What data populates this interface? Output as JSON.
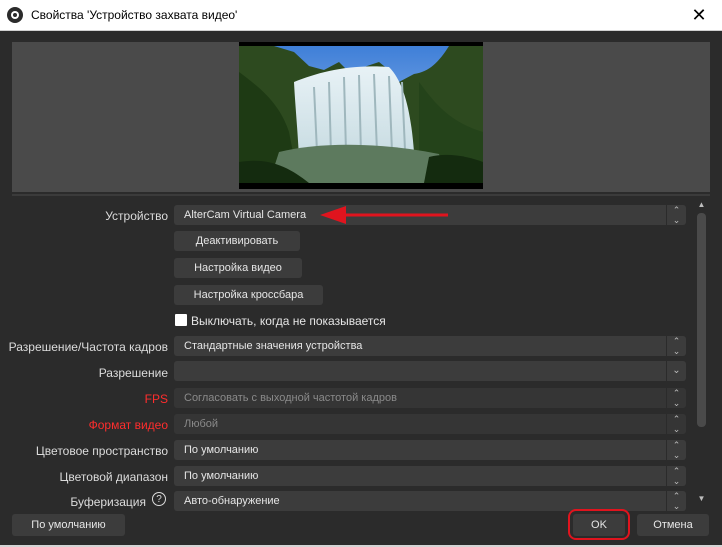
{
  "window": {
    "title": "Свойства 'Устройство захвата видео'",
    "close_glyph": "✕"
  },
  "properties": {
    "device": {
      "label": "Устройство",
      "value": "AlterCam Virtual Camera"
    },
    "deactivate_button": "Деактивировать",
    "video_settings_button": "Настройка видео",
    "crossbar_settings_button": "Настройка кроссбара",
    "hide_when_not_shown": {
      "label": "Выключать, когда не показывается",
      "checked": false
    },
    "resolution_fps_type": {
      "label": "Разрешение/Частота кадров",
      "value": "Стандартные значения устройства"
    },
    "resolution": {
      "label": "Разрешение",
      "value": ""
    },
    "fps": {
      "label": "FPS",
      "value": "Согласовать с выходной частотой кадров"
    },
    "video_format": {
      "label": "Формат видео",
      "value": "Любой"
    },
    "color_space": {
      "label": "Цветовое пространство",
      "value": "По умолчанию"
    },
    "color_range": {
      "label": "Цветовой диапазон",
      "value": "По умолчанию"
    },
    "buffering": {
      "label": "Буферизация",
      "value": "Авто-обнаружение",
      "help_glyph": "?"
    }
  },
  "footer": {
    "defaults_button": "По умолчанию",
    "ok_button": "OK",
    "cancel_button": "Отмена"
  },
  "icons": {
    "combo_arrows": "⌃⌄",
    "combo_arrow_single": "⌄",
    "scroll_up": "▲",
    "scroll_down": "▼"
  },
  "colors": {
    "accent_red": "#e0141e",
    "error_label": "#ff2d2d",
    "panel_bg": "#2b2b2b",
    "control_bg": "#3c3c3c"
  }
}
